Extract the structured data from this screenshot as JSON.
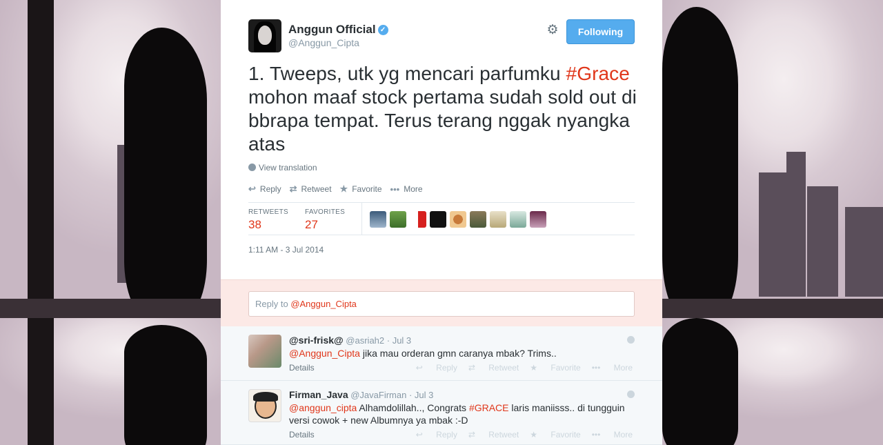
{
  "tweet": {
    "author_name": "Anggun Official",
    "author_handle": "@Anggun_Cipta",
    "follow_label": "Following",
    "text_before": "1. Tweeps, utk yg mencari parfumku ",
    "hashtag": "#Grace",
    "text_after": " mohon maaf stock pertama sudah sold out di bbrapa tempat. Terus terang nggak nyangka atas",
    "view_translation": "View translation",
    "actions": {
      "reply": "Reply",
      "retweet": "Retweet",
      "favorite": "Favorite",
      "more": "More"
    },
    "stats": {
      "retweets_label": "RETWEETS",
      "retweets_value": "38",
      "favorites_label": "FAVORITES",
      "favorites_value": "27"
    },
    "timestamp": "1:11 AM - 3 Jul 2014"
  },
  "reply_box": {
    "prefix": "Reply to ",
    "mention": "@Anggun_Cipta"
  },
  "replies": [
    {
      "name": "@sri-frisk@",
      "handle": "@asriah2",
      "time": "Jul 3",
      "mention": "@Anggun_Cipta",
      "text": " jika mau orderan gmn caranya mbak? Trims..",
      "details": "Details"
    },
    {
      "name": "Firman_Java",
      "handle": "@JavaFirman",
      "time": "Jul 3",
      "mention": "@anggun_cipta",
      "text_before": " Alhamdolillah.., Congrats ",
      "hashtag": "#GRACE",
      "text_after": " laris maniisss.. di tungguin versi cowok + new Albumnya ya mbak :-D",
      "details": "Details"
    }
  ],
  "reply_actions": {
    "reply": "Reply",
    "retweet": "Retweet",
    "favorite": "Favorite",
    "more": "More"
  },
  "colors": {
    "accent": "#e0361a",
    "button": "#55acee",
    "reply_bg": "#fce9e6"
  }
}
